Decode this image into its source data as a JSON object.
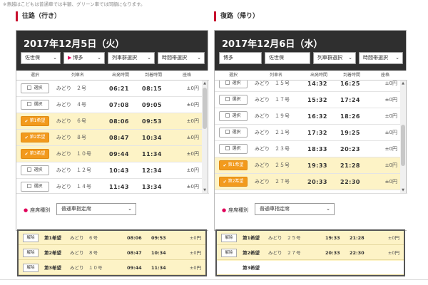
{
  "note": "※意越はこどもは普通車では半額、グリーン車では同額になります。",
  "outbound": {
    "title": "往路（行き）",
    "date": "2017年12月5日（火）",
    "from": "佐世保",
    "to": "博多",
    "line_select": "列車群選択",
    "time_select": "時間帯選択",
    "headers": [
      "選択",
      "列車名",
      "出発時間",
      "到着時間",
      "座格"
    ],
    "rows": [
      {
        "check": "選択",
        "selected": false,
        "name": "みどり　２号",
        "dep": "06:21",
        "arr": "08:15",
        "fare": "±0円"
      },
      {
        "check": "選択",
        "selected": false,
        "name": "みどり　４号",
        "dep": "07:08",
        "arr": "09:05",
        "fare": "±0円"
      },
      {
        "check": "第1希望",
        "selected": true,
        "name": "みどり　６号",
        "dep": "08:06",
        "arr": "09:53",
        "fare": "±0円"
      },
      {
        "check": "第2希望",
        "selected": true,
        "name": "みどり　８号",
        "dep": "08:47",
        "arr": "10:34",
        "fare": "±0円"
      },
      {
        "check": "第3希望",
        "selected": true,
        "name": "みどり　１０号",
        "dep": "09:44",
        "arr": "11:34",
        "fare": "±0円"
      },
      {
        "check": "選択",
        "selected": false,
        "name": "みどり　１２号",
        "dep": "10:43",
        "arr": "12:34",
        "fare": "±0円"
      },
      {
        "check": "選択",
        "selected": false,
        "name": "みどり　１４号",
        "dep": "11:43",
        "arr": "13:34",
        "fare": "±0円"
      }
    ],
    "seat_label": "座席種別",
    "seat_value": "普通車指定席"
  },
  "return": {
    "title": "復路（帰り）",
    "date": "2017年12月6日（水）",
    "from": "博多",
    "to": "佐世保",
    "line_select": "列車群選択",
    "time_select": "時間帯選択",
    "headers": [
      "選択",
      "列車名",
      "出発時間",
      "到着時間",
      "座格"
    ],
    "rows": [
      {
        "check": "選択",
        "selected": false,
        "name": "みどり　１５号",
        "dep": "14:32",
        "arr": "16:25",
        "fare": "±0円"
      },
      {
        "check": "選択",
        "selected": false,
        "name": "みどり　１７号",
        "dep": "15:32",
        "arr": "17:24",
        "fare": "±0円"
      },
      {
        "check": "選択",
        "selected": false,
        "name": "みどり　１９号",
        "dep": "16:32",
        "arr": "18:26",
        "fare": "±0円"
      },
      {
        "check": "選択",
        "selected": false,
        "name": "みどり　２１号",
        "dep": "17:32",
        "arr": "19:25",
        "fare": "±0円"
      },
      {
        "check": "選択",
        "selected": false,
        "name": "みどり　２３号",
        "dep": "18:33",
        "arr": "20:23",
        "fare": "±0円"
      },
      {
        "check": "第1希望",
        "selected": true,
        "name": "みどり　２５号",
        "dep": "19:33",
        "arr": "21:28",
        "fare": "±0円"
      },
      {
        "check": "第2希望",
        "selected": true,
        "name": "みどり　２７号",
        "dep": "20:33",
        "arr": "22:30",
        "fare": "±0円"
      }
    ],
    "seat_label": "座席種別",
    "seat_value": "普通車指定席"
  },
  "summary_out": [
    {
      "release": "解除",
      "pref": "第1希望",
      "name": "みどり　６号",
      "dep": "08:06",
      "arr": "09:53",
      "fare": "±0円"
    },
    {
      "release": "解除",
      "pref": "第2希望",
      "name": "みどり　８号",
      "dep": "08:47",
      "arr": "10:34",
      "fare": "±0円"
    },
    {
      "release": "解除",
      "pref": "第3希望",
      "name": "みどり　１０号",
      "dep": "09:44",
      "arr": "11:34",
      "fare": "±0円"
    }
  ],
  "summary_ret": [
    {
      "release": "解除",
      "pref": "第1希望",
      "name": "みどり　２５号",
      "dep": "19:33",
      "arr": "21:28",
      "fare": "±0円"
    },
    {
      "release": "解除",
      "pref": "第2希望",
      "name": "みどり　２７号",
      "dep": "20:33",
      "arr": "22:30",
      "fare": "±0円"
    },
    {
      "release": "",
      "pref": "第3希望",
      "name": "",
      "dep": "",
      "arr": "",
      "fare": ""
    }
  ],
  "icons": {
    "chevron": "chevron-down-icon",
    "check": "checkmark-icon",
    "scroll_up": "scroll-up-icon",
    "scroll_down": "scroll-down-icon"
  },
  "colors": {
    "header_bg": "#2f2f2f",
    "selected_bg": "#fdf3c6",
    "pick_btn": "#f29a1d",
    "accent": "#c8102e"
  }
}
